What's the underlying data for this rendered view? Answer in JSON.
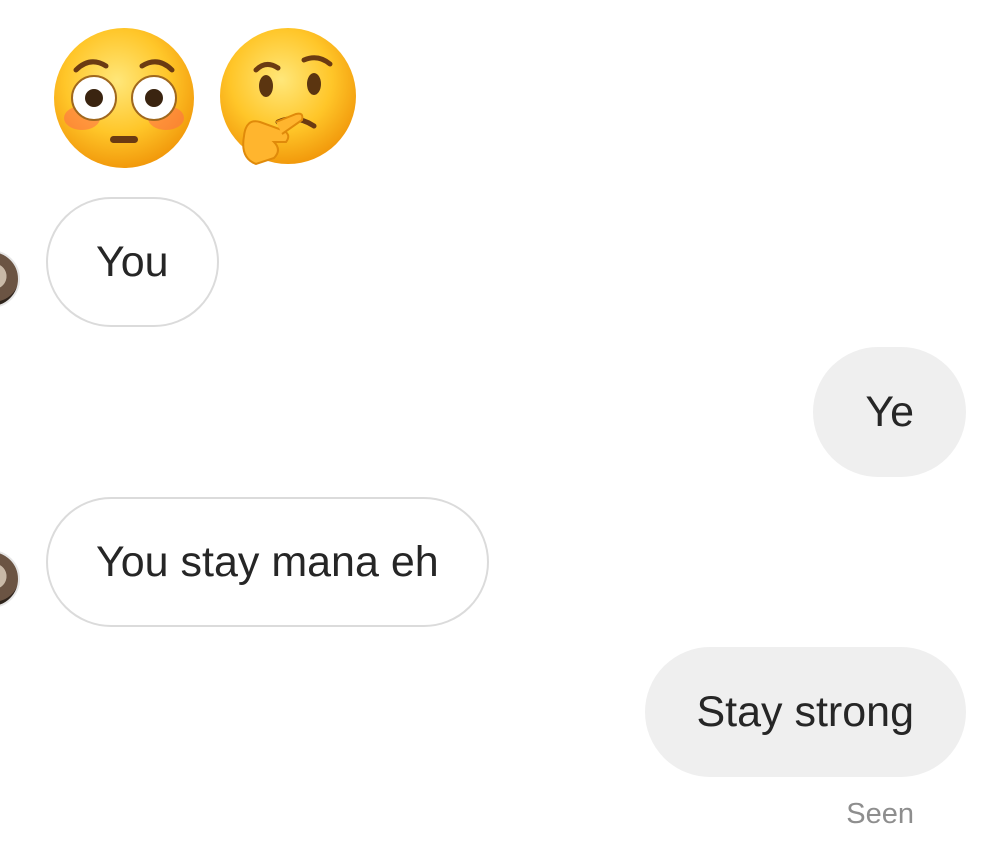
{
  "conversation": {
    "reaction_emojis": [
      "flushed-face",
      "thinking-face"
    ],
    "messages": [
      {
        "direction": "incoming",
        "text": "You"
      },
      {
        "direction": "outgoing",
        "text": "Ye"
      },
      {
        "direction": "incoming",
        "text": "You stay mana eh"
      },
      {
        "direction": "outgoing",
        "text": "Stay strong"
      }
    ],
    "status": "Seen"
  },
  "colors": {
    "incoming_bubble_bg": "#ffffff",
    "incoming_bubble_border": "#dbdbdb",
    "outgoing_bubble_bg": "#efefef",
    "text": "#262626",
    "status_text": "#8e8e8e"
  }
}
